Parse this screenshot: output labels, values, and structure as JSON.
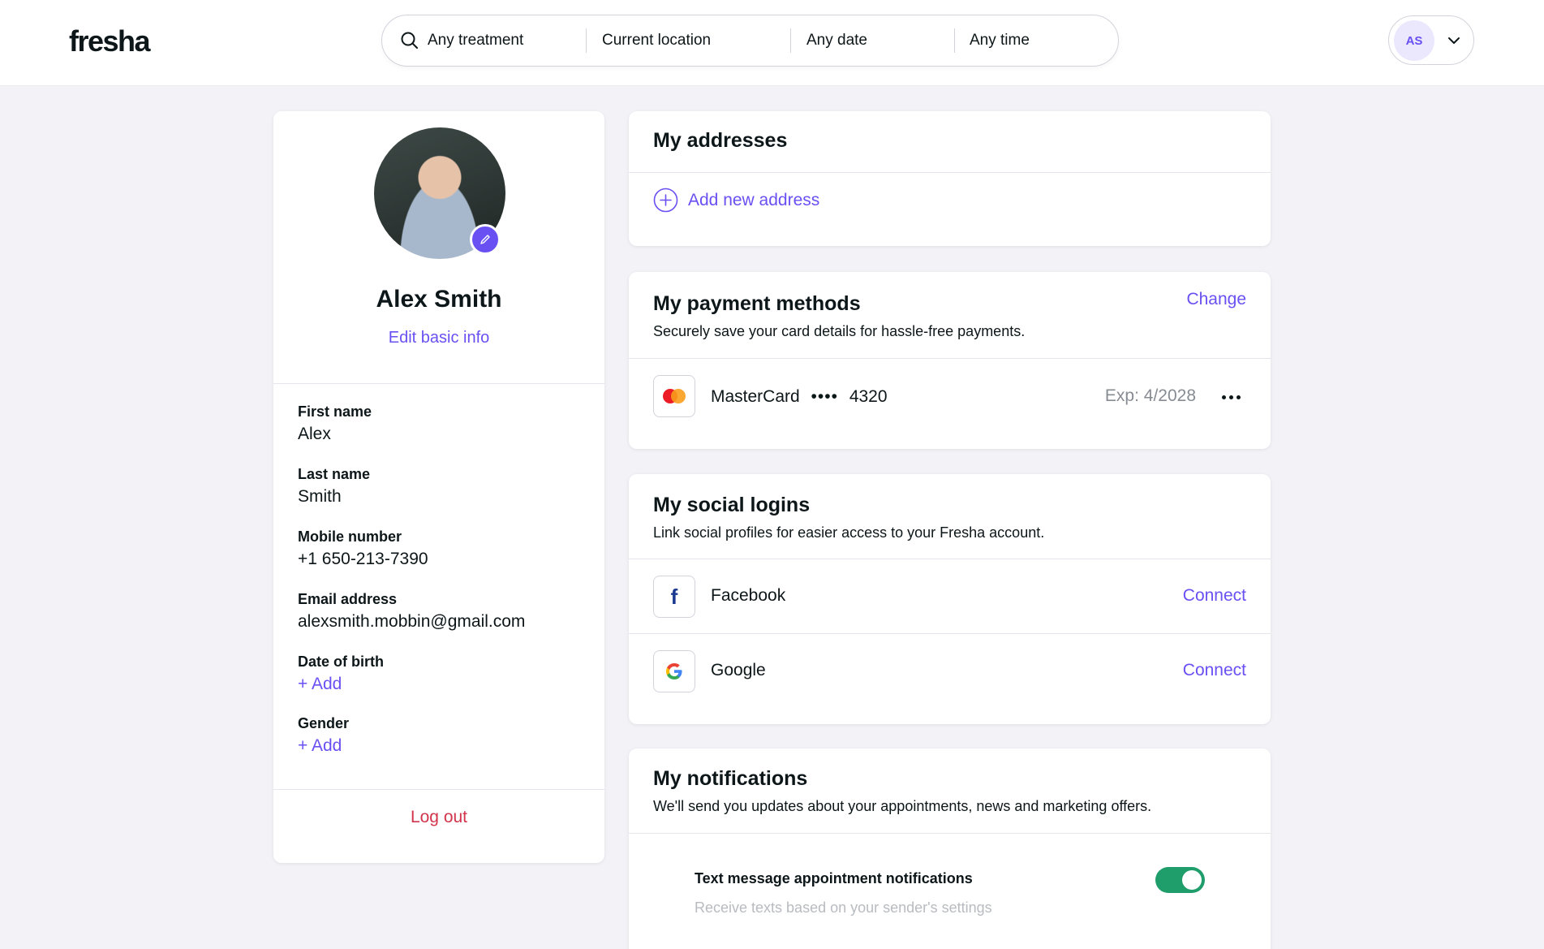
{
  "header": {
    "logo": "fresha",
    "search": {
      "treatment": "Any treatment",
      "location": "Current location",
      "date": "Any date",
      "time": "Any time"
    },
    "user_initials": "AS"
  },
  "profile": {
    "name": "Alex Smith",
    "edit_label": "Edit basic info",
    "fields": [
      {
        "label": "First name",
        "value": "Alex"
      },
      {
        "label": "Last name",
        "value": "Smith"
      },
      {
        "label": "Mobile number",
        "value": "+1 650-213-7390"
      },
      {
        "label": "Email address",
        "value": "alexsmith.mobbin@gmail.com"
      },
      {
        "label": "Date of birth",
        "value": "+ Add"
      },
      {
        "label": "Gender",
        "value": "+ Add"
      }
    ],
    "logout_label": "Log out"
  },
  "addresses": {
    "title": "My addresses",
    "add_label": "Add new address"
  },
  "payment": {
    "title": "My payment methods",
    "subtitle": "Securely save your card details for hassle-free payments.",
    "change_label": "Change",
    "card": {
      "brand": "MasterCard",
      "mask": "••••",
      "last4": "4320",
      "expiry": "Exp: 4/2028"
    }
  },
  "social": {
    "title": "My social logins",
    "subtitle": "Link social profiles for easier access to your Fresha account.",
    "providers": [
      {
        "name": "Facebook",
        "action": "Connect"
      },
      {
        "name": "Google",
        "action": "Connect"
      }
    ]
  },
  "notifications": {
    "title": "My notifications",
    "subtitle": "We'll send you updates about your appointments, news and marketing offers.",
    "items": [
      {
        "label": "Text message appointment notifications",
        "description": "Receive texts based on your sender's settings",
        "enabled": true
      }
    ]
  },
  "colors": {
    "accent": "#6950f3",
    "danger": "#d1344b",
    "toggle_on": "#1f9d6a",
    "background": "#f2f2f7"
  }
}
